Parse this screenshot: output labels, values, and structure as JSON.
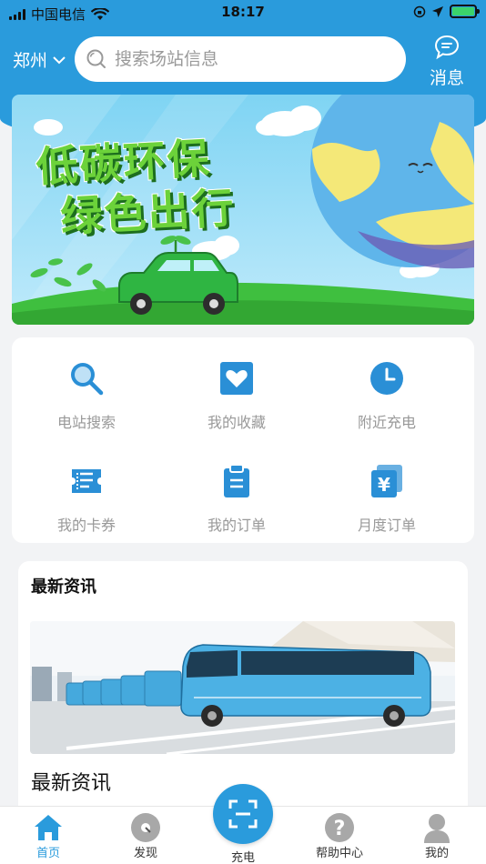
{
  "status_bar": {
    "carrier": "中国电信",
    "time": "18:17"
  },
  "header": {
    "city": "郑州",
    "search_placeholder": "搜索场站信息",
    "message_label": "消息"
  },
  "banner": {
    "title_line1": "低碳环保",
    "title_line2": "绿色出行"
  },
  "menu": {
    "items": [
      {
        "label": "电站搜索",
        "icon": "search-icon"
      },
      {
        "label": "我的收藏",
        "icon": "heart-icon"
      },
      {
        "label": "附近充电",
        "icon": "clock-icon"
      },
      {
        "label": "我的卡券",
        "icon": "ticket-icon"
      },
      {
        "label": "我的订单",
        "icon": "clipboard-icon"
      },
      {
        "label": "月度订单",
        "icon": "yen-icon"
      }
    ]
  },
  "news": {
    "section_title": "最新资讯",
    "headline": "最新资讯"
  },
  "tab_bar": {
    "home": "首页",
    "discover": "发现",
    "charge": "充电",
    "help": "帮助中心",
    "mine": "我的"
  },
  "colors": {
    "primary": "#2a9bdc",
    "icon_blue": "#2a8fd6"
  }
}
